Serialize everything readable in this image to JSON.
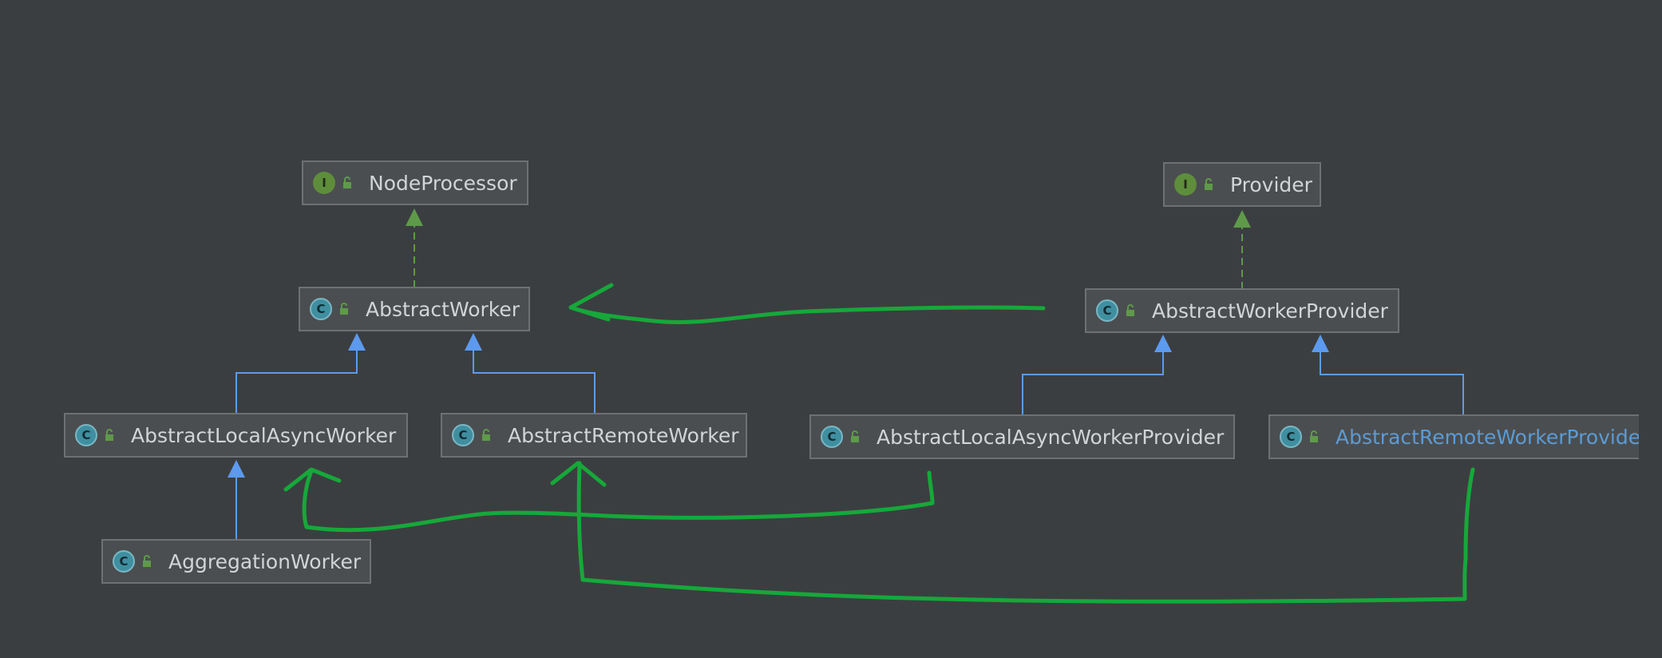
{
  "colors": {
    "background": "#3b3e40",
    "node_fill": "#4b4e50",
    "node_border": "#6e7173",
    "text": "#d2d4d6",
    "implements_arrow": "#5e9a4a",
    "extends_arrow": "#5c9aef",
    "annotation_stroke": "#16a83a",
    "highlight_text": "#5b9bd5"
  },
  "nodes": {
    "node_processor": {
      "kind": "I",
      "icon": "interface-icon",
      "label": "NodeProcessor"
    },
    "abstract_worker": {
      "kind": "C",
      "icon": "class-icon",
      "label": "AbstractWorker"
    },
    "abstract_local_async_worker": {
      "kind": "C",
      "icon": "class-icon",
      "label": "AbstractLocalAsyncWorker"
    },
    "abstract_remote_worker": {
      "kind": "C",
      "icon": "class-icon",
      "label": "AbstractRemoteWorker"
    },
    "aggregation_worker": {
      "kind": "C",
      "icon": "class-icon",
      "label": "AggregationWorker"
    },
    "provider": {
      "kind": "I",
      "icon": "interface-icon",
      "label": "Provider"
    },
    "abstract_worker_provider": {
      "kind": "C",
      "icon": "class-icon",
      "label": "AbstractWorkerProvider"
    },
    "abstract_local_async_worker_provider": {
      "kind": "C",
      "icon": "class-icon",
      "label": "AbstractLocalAsyncWorkerProvider"
    },
    "abstract_remote_worker_provider": {
      "kind": "C",
      "icon": "class-icon",
      "label": "AbstractRemoteWorkerProvider"
    }
  },
  "edges": [
    {
      "from": "abstract_worker",
      "to": "node_processor",
      "type": "implements"
    },
    {
      "from": "abstract_local_async_worker",
      "to": "abstract_worker",
      "type": "extends"
    },
    {
      "from": "abstract_remote_worker",
      "to": "abstract_worker",
      "type": "extends"
    },
    {
      "from": "aggregation_worker",
      "to": "abstract_local_async_worker",
      "type": "extends"
    },
    {
      "from": "abstract_worker_provider",
      "to": "provider",
      "type": "implements"
    },
    {
      "from": "abstract_local_async_worker_provider",
      "to": "abstract_worker_provider",
      "type": "extends"
    },
    {
      "from": "abstract_remote_worker_provider",
      "to": "abstract_worker_provider",
      "type": "extends"
    }
  ],
  "annotations": [
    {
      "from": "abstract_worker_provider",
      "to": "abstract_worker"
    },
    {
      "from": "abstract_local_async_worker_provider",
      "to": "abstract_local_async_worker"
    },
    {
      "from": "abstract_remote_worker_provider",
      "to": "abstract_remote_worker"
    }
  ]
}
